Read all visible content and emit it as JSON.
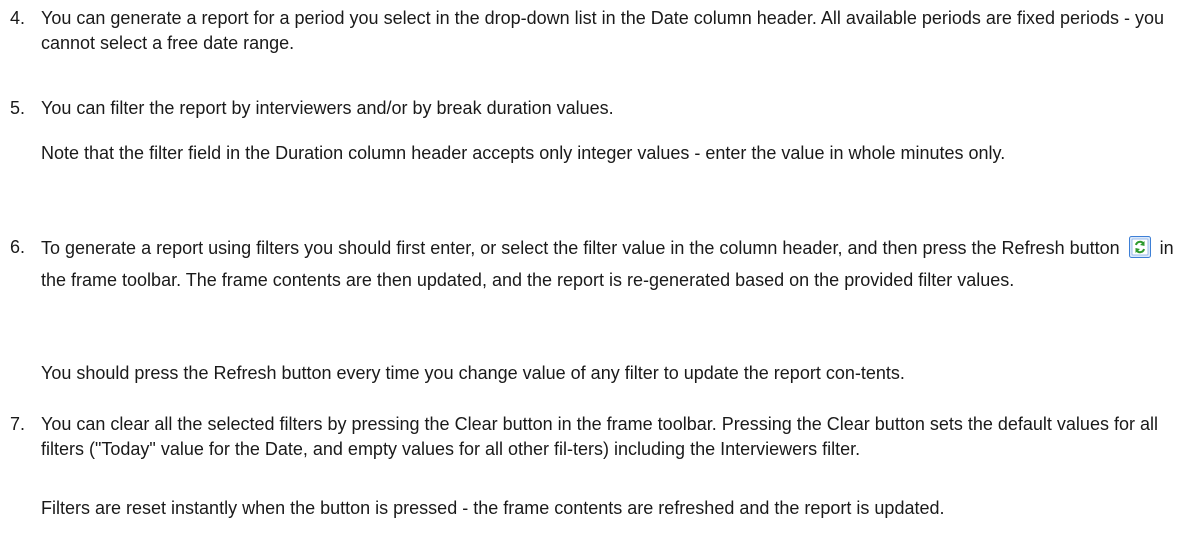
{
  "items": [
    {
      "number": "4.",
      "paragraphs": [
        "You can generate a report for a period you select in the drop-down list in the Date column header. All available periods are fixed periods - you cannot select a free date range."
      ]
    },
    {
      "number": "5.",
      "paragraphs": [
        "You can filter the report by interviewers and/or by break duration values.",
        "Note that the filter field in the Duration column header accepts only integer values - enter the value in whole minutes only."
      ]
    },
    {
      "number": "6.",
      "p1_before_icon": "To generate a report using filters you should first enter, or select the filter value in the column header, and then press the Refresh button",
      "p1_after_icon": "in the frame toolbar. The frame contents are then updated, and the report is re-generated based on the provided filter values.",
      "p2": "You should press the Refresh button every time you change value of any filter to update the report con-tents.",
      "icon": "refresh-icon"
    },
    {
      "number": "7.",
      "paragraphs": [
        "You can clear all the selected filters by pressing the Clear button in the frame toolbar. Pressing the Clear button sets the default values for all filters (\"Today\" value for the Date, and empty values for all other fil-ters) including the Interviewers filter.",
        "Filters are reset instantly when the button is pressed - the frame contents are refreshed and the report is updated."
      ]
    }
  ],
  "colors": {
    "text": "#1a1a1a",
    "icon_green": "#2e9a2e",
    "icon_blue": "#3d7fd6"
  }
}
